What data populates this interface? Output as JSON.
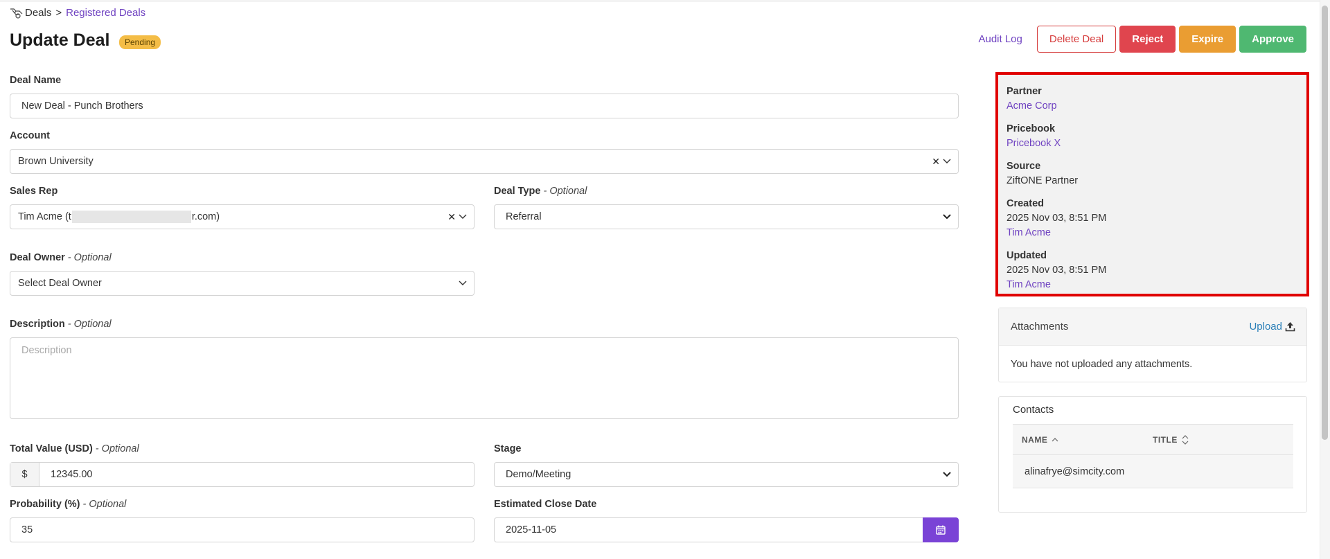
{
  "breadcrumb": {
    "root": "Deals",
    "separator": ">",
    "current": "Registered Deals"
  },
  "page": {
    "title": "Update Deal",
    "status": "Pending"
  },
  "actions": {
    "audit_log": "Audit Log",
    "delete": "Delete Deal",
    "reject": "Reject",
    "expire": "Expire",
    "approve": "Approve"
  },
  "form": {
    "optional_suffix": " - Optional",
    "deal_name": {
      "label": "Deal Name",
      "value": "New Deal - Punch Brothers"
    },
    "account": {
      "label": "Account",
      "value": "Brown University"
    },
    "sales_rep": {
      "label": "Sales Rep",
      "value_prefix": "Tim Acme (t",
      "value_suffix": "r.com)"
    },
    "deal_type": {
      "label": "Deal Type",
      "value": "Referral"
    },
    "deal_owner": {
      "label": "Deal Owner",
      "placeholder": "Select Deal Owner"
    },
    "description": {
      "label": "Description",
      "placeholder": "Description"
    },
    "total_value": {
      "label": "Total Value (USD)",
      "currency": "$",
      "value": "12345.00"
    },
    "stage": {
      "label": "Stage",
      "value": "Demo/Meeting"
    },
    "probability": {
      "label": "Probability (%)",
      "value": "35"
    },
    "close_date": {
      "label": "Estimated Close Date",
      "value": "2025-11-05"
    }
  },
  "info": {
    "partner": {
      "label": "Partner",
      "value": "Acme Corp"
    },
    "pricebook": {
      "label": "Pricebook",
      "value": "Pricebook X"
    },
    "source": {
      "label": "Source",
      "value": "ZiftONE Partner"
    },
    "created": {
      "label": "Created",
      "date": "2025 Nov 03, 8:51 PM",
      "by": "Tim Acme"
    },
    "updated": {
      "label": "Updated",
      "date": "2025 Nov 03, 8:51 PM",
      "by": "Tim Acme"
    }
  },
  "attachments": {
    "title": "Attachments",
    "upload": "Upload",
    "empty": "You have not uploaded any attachments."
  },
  "contacts": {
    "title": "Contacts",
    "columns": [
      "NAME",
      "TITLE"
    ],
    "rows": [
      {
        "name": "alinafrye@simcity.com",
        "title": ""
      }
    ]
  },
  "colors": {
    "accent": "#6f42c1",
    "highlight_border": "#e00000",
    "reject": "#e0454e",
    "expire": "#ea9d32",
    "approve": "#4fb871",
    "badge": "#f4bd46"
  }
}
